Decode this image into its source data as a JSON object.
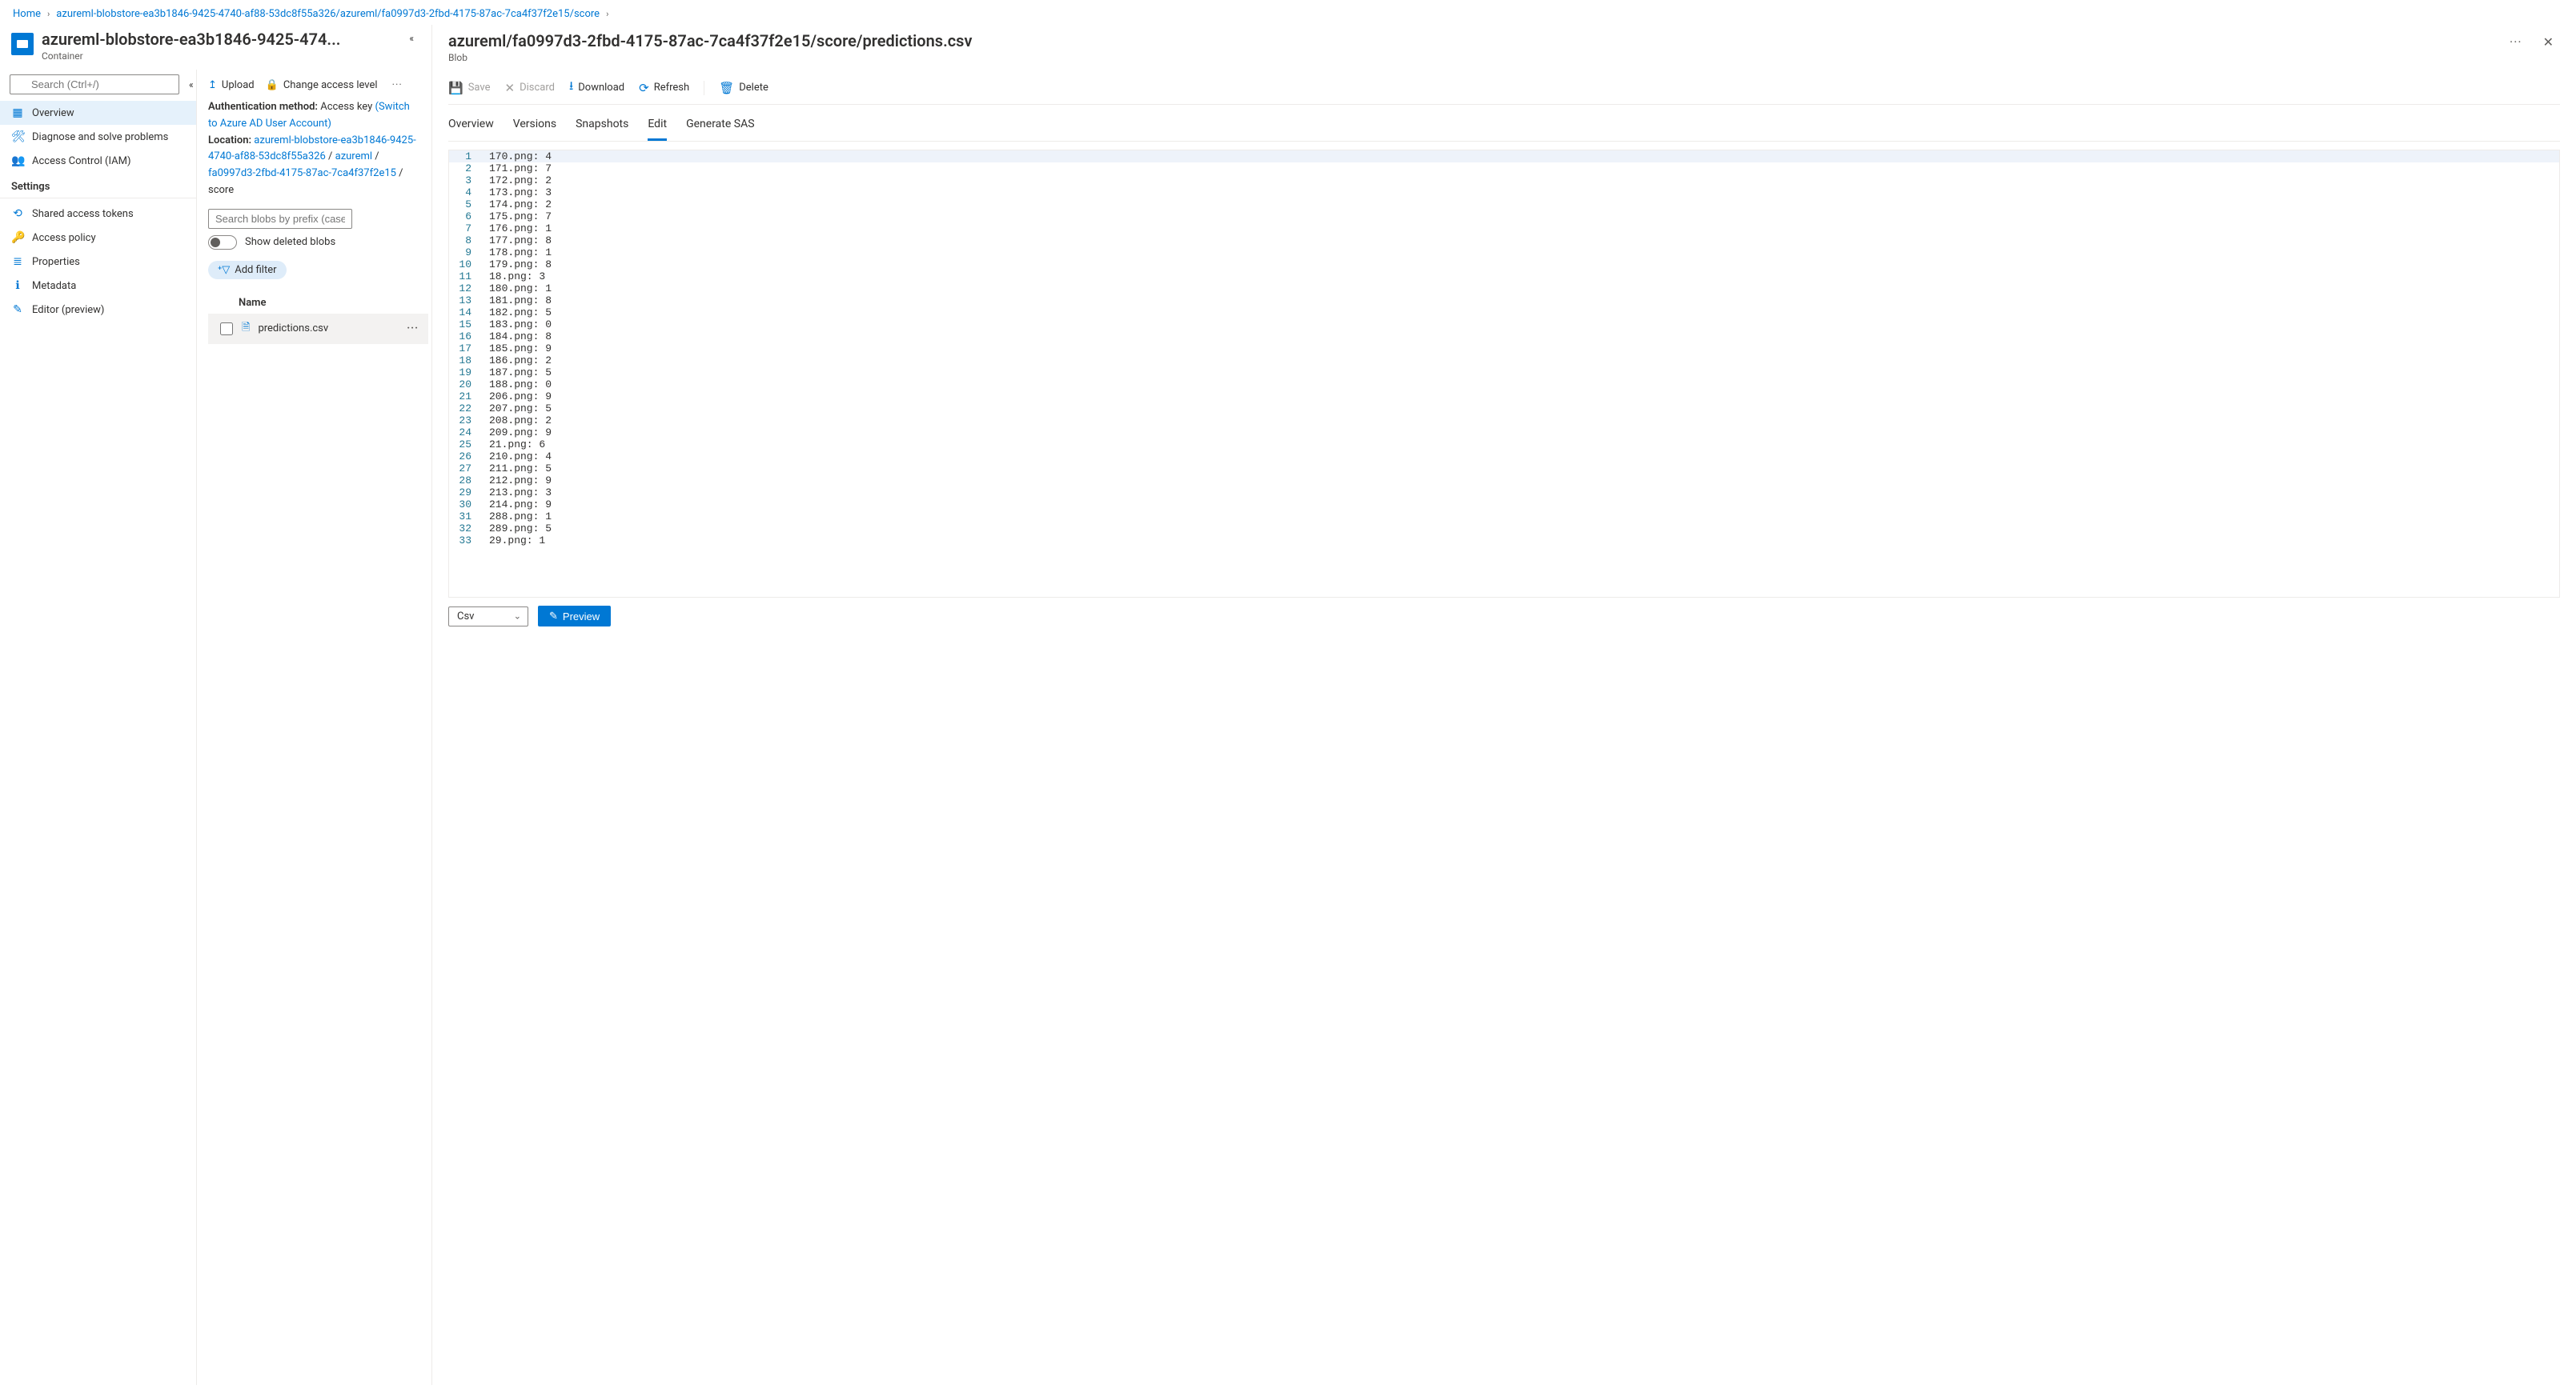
{
  "breadcrumb": {
    "home": "Home",
    "path": "azureml-blobstore-ea3b1846-9425-4740-af88-53dc8f55a326/azureml/fa0997d3-2fbd-4175-87ac-7ca4f37f2e15/score"
  },
  "container": {
    "title": "azureml-blobstore-ea3b1846-9425-474...",
    "subtitle": "Container"
  },
  "sidebar": {
    "search_placeholder": "Search (Ctrl+/)",
    "items": [
      {
        "icon": "overview-icon",
        "label": "Overview",
        "active": true
      },
      {
        "icon": "diagnose-icon",
        "label": "Diagnose and solve problems"
      },
      {
        "icon": "iam-icon",
        "label": "Access Control (IAM)"
      }
    ],
    "settings_label": "Settings",
    "settings_items": [
      {
        "icon": "token-icon",
        "label": "Shared access tokens"
      },
      {
        "icon": "key-icon",
        "label": "Access policy"
      },
      {
        "icon": "props-icon",
        "label": "Properties"
      },
      {
        "icon": "metadata-icon",
        "label": "Metadata"
      },
      {
        "icon": "editor-icon",
        "label": "Editor (preview)"
      }
    ]
  },
  "mid": {
    "toolbar": {
      "upload": "Upload",
      "change_access": "Change access level",
      "more": "···"
    },
    "auth_label": "Authentication method:",
    "auth_value": "Access key",
    "auth_switch": "(Switch to Azure AD User Account)",
    "location_label": "Location:",
    "loc_parts": [
      "azureml-blobstore-ea3b1846-9425-4740-af88-53dc8f55a326",
      "azureml",
      "fa0997d3-2fbd-4175-87ac-7ca4f37f2e15"
    ],
    "loc_tail": "score",
    "prefix_placeholder": "Search blobs by prefix (case-sensitive)",
    "show_deleted": "Show deleted blobs",
    "add_filter": "Add filter",
    "col_name": "Name",
    "row_file": "predictions.csv"
  },
  "right": {
    "title": "azureml/fa0997d3-2fbd-4175-87ac-7ca4f37f2e15/score/predictions.csv",
    "subtitle": "Blob",
    "cmds": {
      "save": "Save",
      "discard": "Discard",
      "download": "Download",
      "refresh": "Refresh",
      "delete": "Delete"
    },
    "tabs": [
      {
        "label": "Overview"
      },
      {
        "label": "Versions"
      },
      {
        "label": "Snapshots"
      },
      {
        "label": "Edit",
        "active": true
      },
      {
        "label": "Generate SAS"
      }
    ],
    "editor_lines": [
      "170.png: 4",
      "171.png: 7",
      "172.png: 2",
      "173.png: 3",
      "174.png: 2",
      "175.png: 7",
      "176.png: 1",
      "177.png: 8",
      "178.png: 1",
      "179.png: 8",
      "18.png: 3",
      "180.png: 1",
      "181.png: 8",
      "182.png: 5",
      "183.png: 0",
      "184.png: 8",
      "185.png: 9",
      "186.png: 2",
      "187.png: 5",
      "188.png: 0",
      "206.png: 9",
      "207.png: 5",
      "208.png: 2",
      "209.png: 9",
      "21.png: 6",
      "210.png: 4",
      "211.png: 5",
      "212.png: 9",
      "213.png: 3",
      "214.png: 9",
      "288.png: 1",
      "289.png: 5",
      "29.png: 1"
    ],
    "format_select": "Csv",
    "preview_btn": "Preview"
  }
}
